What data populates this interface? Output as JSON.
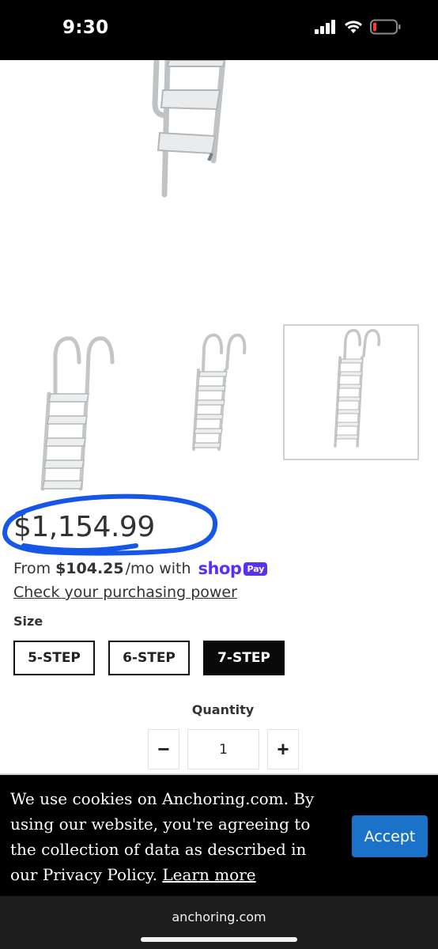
{
  "status": {
    "time": "9:30"
  },
  "product": {
    "price": "$1,154.99",
    "installment_prefix": "From",
    "installment_amount": "$104.25",
    "installment_suffix": "/mo with",
    "shop_logo": "shop",
    "shop_pay_badge": "Pay",
    "power_link": "Check your purchasing power",
    "size_label": "Size",
    "sizes": [
      {
        "label": "5-STEP",
        "selected": false
      },
      {
        "label": "6-STEP",
        "selected": false
      },
      {
        "label": "7-STEP",
        "selected": true
      }
    ],
    "quantity_label": "Quantity",
    "quantity_value": "1",
    "minus_symbol": "−",
    "plus_symbol": "+"
  },
  "cookie": {
    "text": "We use cookies on Anchoring.com. By using our website, you're agreeing to the collection of data as described in our Privacy Policy.",
    "learn_more": "Learn more",
    "accept_label": "Accept"
  },
  "browser": {
    "url": "anchoring.com"
  },
  "colors": {
    "shop_purple": "#5a31f4",
    "accept_blue": "#1a73c9",
    "annotation_blue": "#1657e8"
  }
}
